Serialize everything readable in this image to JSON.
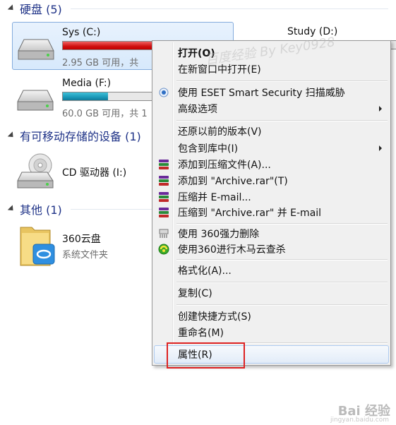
{
  "groups": {
    "hdd": {
      "title": "硬盘 (5)"
    },
    "removable": {
      "title": "有可移动存储的设备 (1)"
    },
    "other": {
      "title": "其他 (1)"
    }
  },
  "drives": {
    "sys": {
      "name": "Sys (C:)",
      "info": "2.95 GB 可用，共",
      "used_fraction": 0.85
    },
    "study": {
      "name": "Study (D:)",
      "used_fraction": 0.5
    },
    "media": {
      "name": "Media (F:)",
      "info": "60.0 GB 可用，共 1",
      "used_fraction": 0.5
    },
    "cd": {
      "name": "CD 驱动器 (I:)"
    },
    "cloud": {
      "name": "360云盘",
      "info": "系统文件夹"
    }
  },
  "menu": {
    "open": "打开(O)",
    "open_new_window": "在新窗口中打开(E)",
    "eset_scan": "使用 ESET Smart Security 扫描威胁",
    "advanced": "高级选项",
    "restore_previous": "还原以前的版本(V)",
    "include_library": "包含到库中(I)",
    "add_archive": "添加到压缩文件(A)...",
    "add_archive_rar": "添加到 \"Archive.rar\"(T)",
    "compress_email": "压缩并 E-mail...",
    "compress_rar_email": "压缩到 \"Archive.rar\" 并 E-mail",
    "force_delete_360": "使用 360强力删除",
    "cloud_scan_360": "使用360进行木马云查杀",
    "format": "格式化(A)...",
    "copy": "复制(C)",
    "create_shortcut": "创建快捷方式(S)",
    "rename": "重命名(M)",
    "properties": "属性(R)"
  },
  "watermark": {
    "top": "百度经验 By Key0928",
    "brand": "Bai 经验",
    "brand_sub": "jingyan.baidu.com"
  },
  "colors": {
    "selection_border": "#84acdd",
    "bar_red": "#d01010",
    "bar_teal": "#1a98b8",
    "highlight_box": "#dd2222"
  }
}
